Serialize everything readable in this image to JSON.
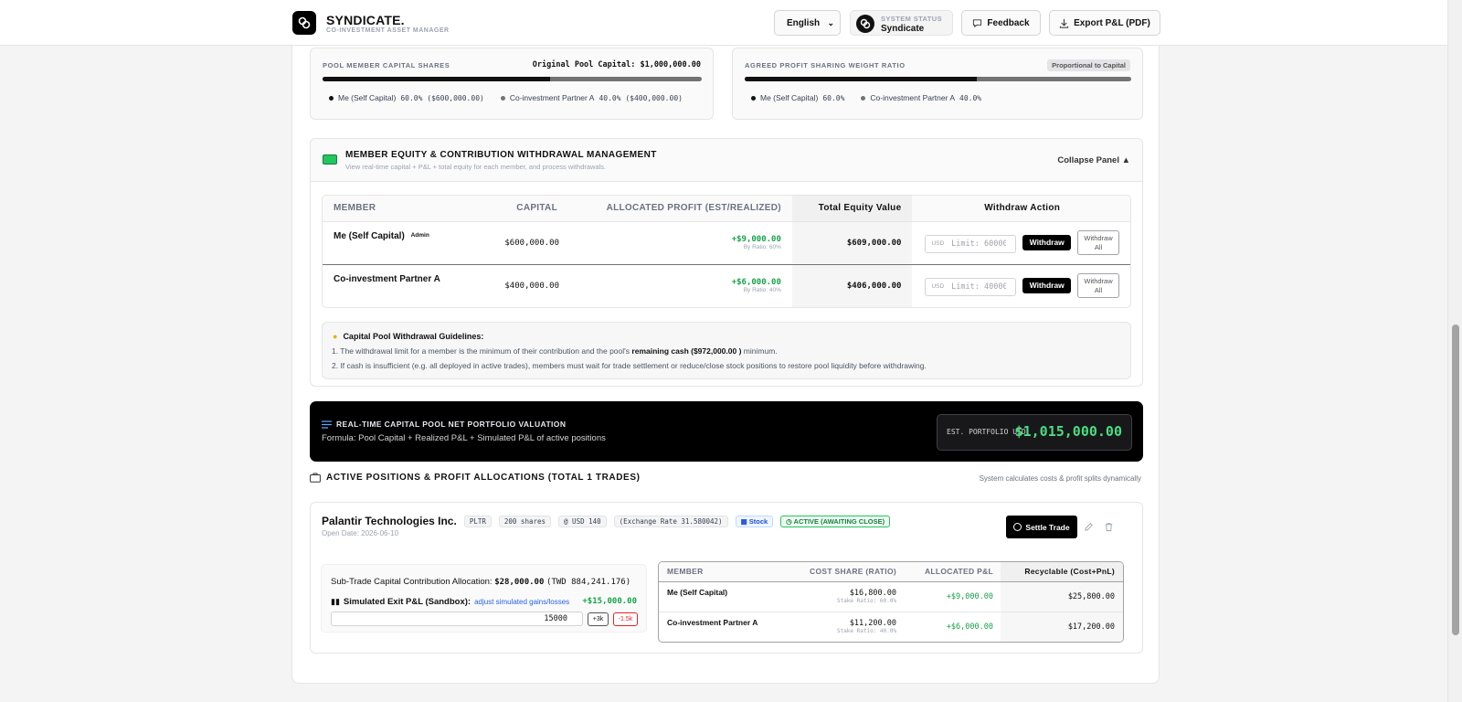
{
  "header": {
    "app_name": "SYNDICATE.",
    "app_subtitle": "CO-INVESTMENT ASSET MANAGER",
    "language": "English",
    "status_label": "SYSTEM STATUS",
    "status_value": "Syndicate",
    "feedback_label": "Feedback",
    "export_label": "Export P&L (PDF)"
  },
  "capital_shares": {
    "title": "POOL MEMBER CAPITAL SHARES",
    "original_pool": "Original Pool Capital: $1,000,000.00",
    "self_fraction": 0.6,
    "members": [
      {
        "label": "Me (Self Capital)",
        "value": "60.0% ($600,000.00)",
        "color": "#111111"
      },
      {
        "label": "Co-investment Partner A",
        "value": "40.0% ($400,000.00)",
        "color": "#737373"
      }
    ]
  },
  "profit_ratio": {
    "title": "AGREED PROFIT SHARING WEIGHT RATIO",
    "badge": "Proportional to Capital",
    "self_fraction": 0.6,
    "members": [
      {
        "label": "Me (Self Capital)",
        "value": "60.0%",
        "color": "#111111"
      },
      {
        "label": "Co-investment Partner A",
        "value": "40.0%",
        "color": "#737373"
      }
    ]
  },
  "equity_panel": {
    "icon": "money-icon",
    "title": "MEMBER EQUITY & CONTRIBUTION WITHDRAWAL MANAGEMENT",
    "subtitle": "View real-time capital + P&L + total equity for each member, and process withdrawals.",
    "collapse_label": "Collapse Panel ▲",
    "columns": [
      "MEMBER",
      "CAPITAL",
      "ALLOCATED PROFIT (EST/REALIZED)",
      "Total Equity Value",
      "Withdraw Action"
    ],
    "rows": [
      {
        "member": "Me (Self Capital)",
        "badge": "Admin",
        "capital": "$600,000.00",
        "profit": "+$9,000.00",
        "ratio": "By Ratio: 60%",
        "equity": "$609,000.00",
        "currency": "USD",
        "placeholder": "Limit: 60000",
        "withdraw": "Withdraw",
        "withdraw_all_1": "Withdraw",
        "withdraw_all_2": "All"
      },
      {
        "member": "Co-investment Partner A",
        "badge": "",
        "capital": "$400,000.00",
        "profit": "+$6,000.00",
        "ratio": "By Ratio: 40%",
        "equity": "$406,000.00",
        "currency": "USD",
        "placeholder": "Limit: 40000",
        "withdraw": "Withdraw",
        "withdraw_all_1": "Withdraw",
        "withdraw_all_2": "All"
      }
    ],
    "guidelines_title": "Capital Pool Withdrawal Guidelines:",
    "guideline_1_pre": "1. The withdrawal limit for a member is the minimum of their contribution and the pool's",
    "guideline_1_bold": "remaining cash ($972,000.00 )",
    "guideline_1_post": "minimum.",
    "guideline_2": "2. If cash is insufficient (e.g. all deployed in active trades), members must wait for trade settlement or reduce/close stock positions to restore pool liquidity before withdrawing."
  },
  "valuation": {
    "title": "REAL-TIME CAPITAL POOL NET PORTFOLIO VALUATION",
    "formula": "Formula: Pool Capital + Realized P&L + Simulated P&L of active positions",
    "est_label": "EST. PORTFOLIO USD",
    "est_value": "$1,015,000.00"
  },
  "positions": {
    "title": "ACTIVE POSITIONS & PROFIT ALLOCATIONS (TOTAL 1 TRADES)",
    "hint": "System calculates costs & profit splits dynamically",
    "trade": {
      "name": "Palantir Technologies Inc.",
      "ticker": "PLTR",
      "shares": "200 shares",
      "price": "@ USD 140",
      "fx": "(Exchange Rate 31.580042)",
      "type": "Stock",
      "status": "ACTIVE (AWAITING CLOSE)",
      "open_date": "Open Date: 2026-06-10",
      "settle_label": "Settle Trade",
      "allocation_label": "Sub-Trade Capital Contribution Allocation:",
      "allocation_value": "$28,000.00",
      "allocation_twd": "(TWD 884,241.176)",
      "sim_label": "Simulated Exit P&L (Sandbox):",
      "sim_link": "adjust simulated gains/losses",
      "sim_value": "+$15,000.00",
      "sim_input": "15000",
      "plus_btn": "+3k",
      "minus_btn": "-1.5k",
      "alloc_columns": [
        "MEMBER",
        "COST SHARE (RATIO)",
        "ALLOCATED P&L",
        "Recyclable (Cost+PnL)"
      ],
      "alloc_rows": [
        {
          "member": "Me (Self Capital)",
          "cost": "$16,800.00",
          "ratio": "Stake Ratio: 60.0%",
          "pnl": "+$9,000.00",
          "recyclable": "$25,800.00"
        },
        {
          "member": "Co-investment Partner A",
          "cost": "$11,200.00",
          "ratio": "Stake Ratio: 40.0%",
          "pnl": "+$6,000.00",
          "recyclable": "$17,200.00"
        }
      ]
    }
  }
}
